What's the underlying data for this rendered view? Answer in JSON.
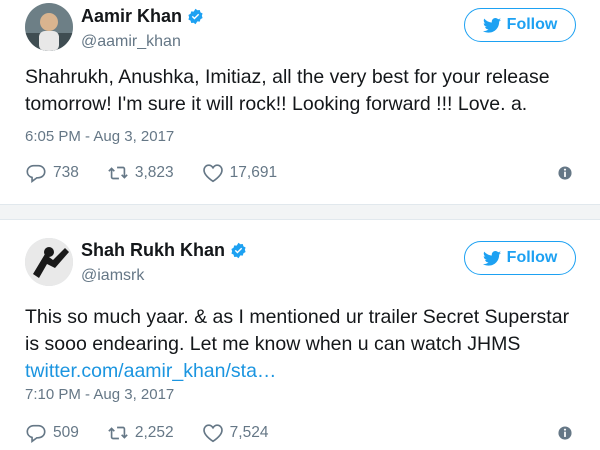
{
  "tweets": [
    {
      "display_name": "Aamir Khan",
      "handle": "@aamir_khan",
      "follow_label": "Follow",
      "text_lines": [
        "Shahrukh, Anushka, Imitiaz, all the very best for your release",
        "tomorrow! I'm sure it will rock!! Looking forward !!! Love. a."
      ],
      "timestamp": "6:05 PM - Aug 3, 2017",
      "replies": "738",
      "retweets": "3,823",
      "likes": "17,691"
    },
    {
      "display_name": "Shah Rukh Khan",
      "handle": "@iamsrk",
      "follow_label": "Follow",
      "text_lines": [
        "This so much yaar. & as I mentioned ur trailer Secret Superstar",
        "is sooo endearing. Let me know when u can watch JHMS"
      ],
      "link_text": "twitter.com/aamir_khan/sta…",
      "timestamp": "7:10 PM - Aug 3, 2017",
      "replies": "509",
      "retweets": "2,252",
      "likes": "7,524"
    }
  ],
  "colors": {
    "accent": "#1da1f2",
    "link": "#1b95e0",
    "muted": "#657786",
    "text": "#14171a"
  },
  "icons": [
    "verified-badge-icon",
    "twitter-bird-icon",
    "reply-icon",
    "retweet-icon",
    "heart-icon",
    "info-icon"
  ]
}
